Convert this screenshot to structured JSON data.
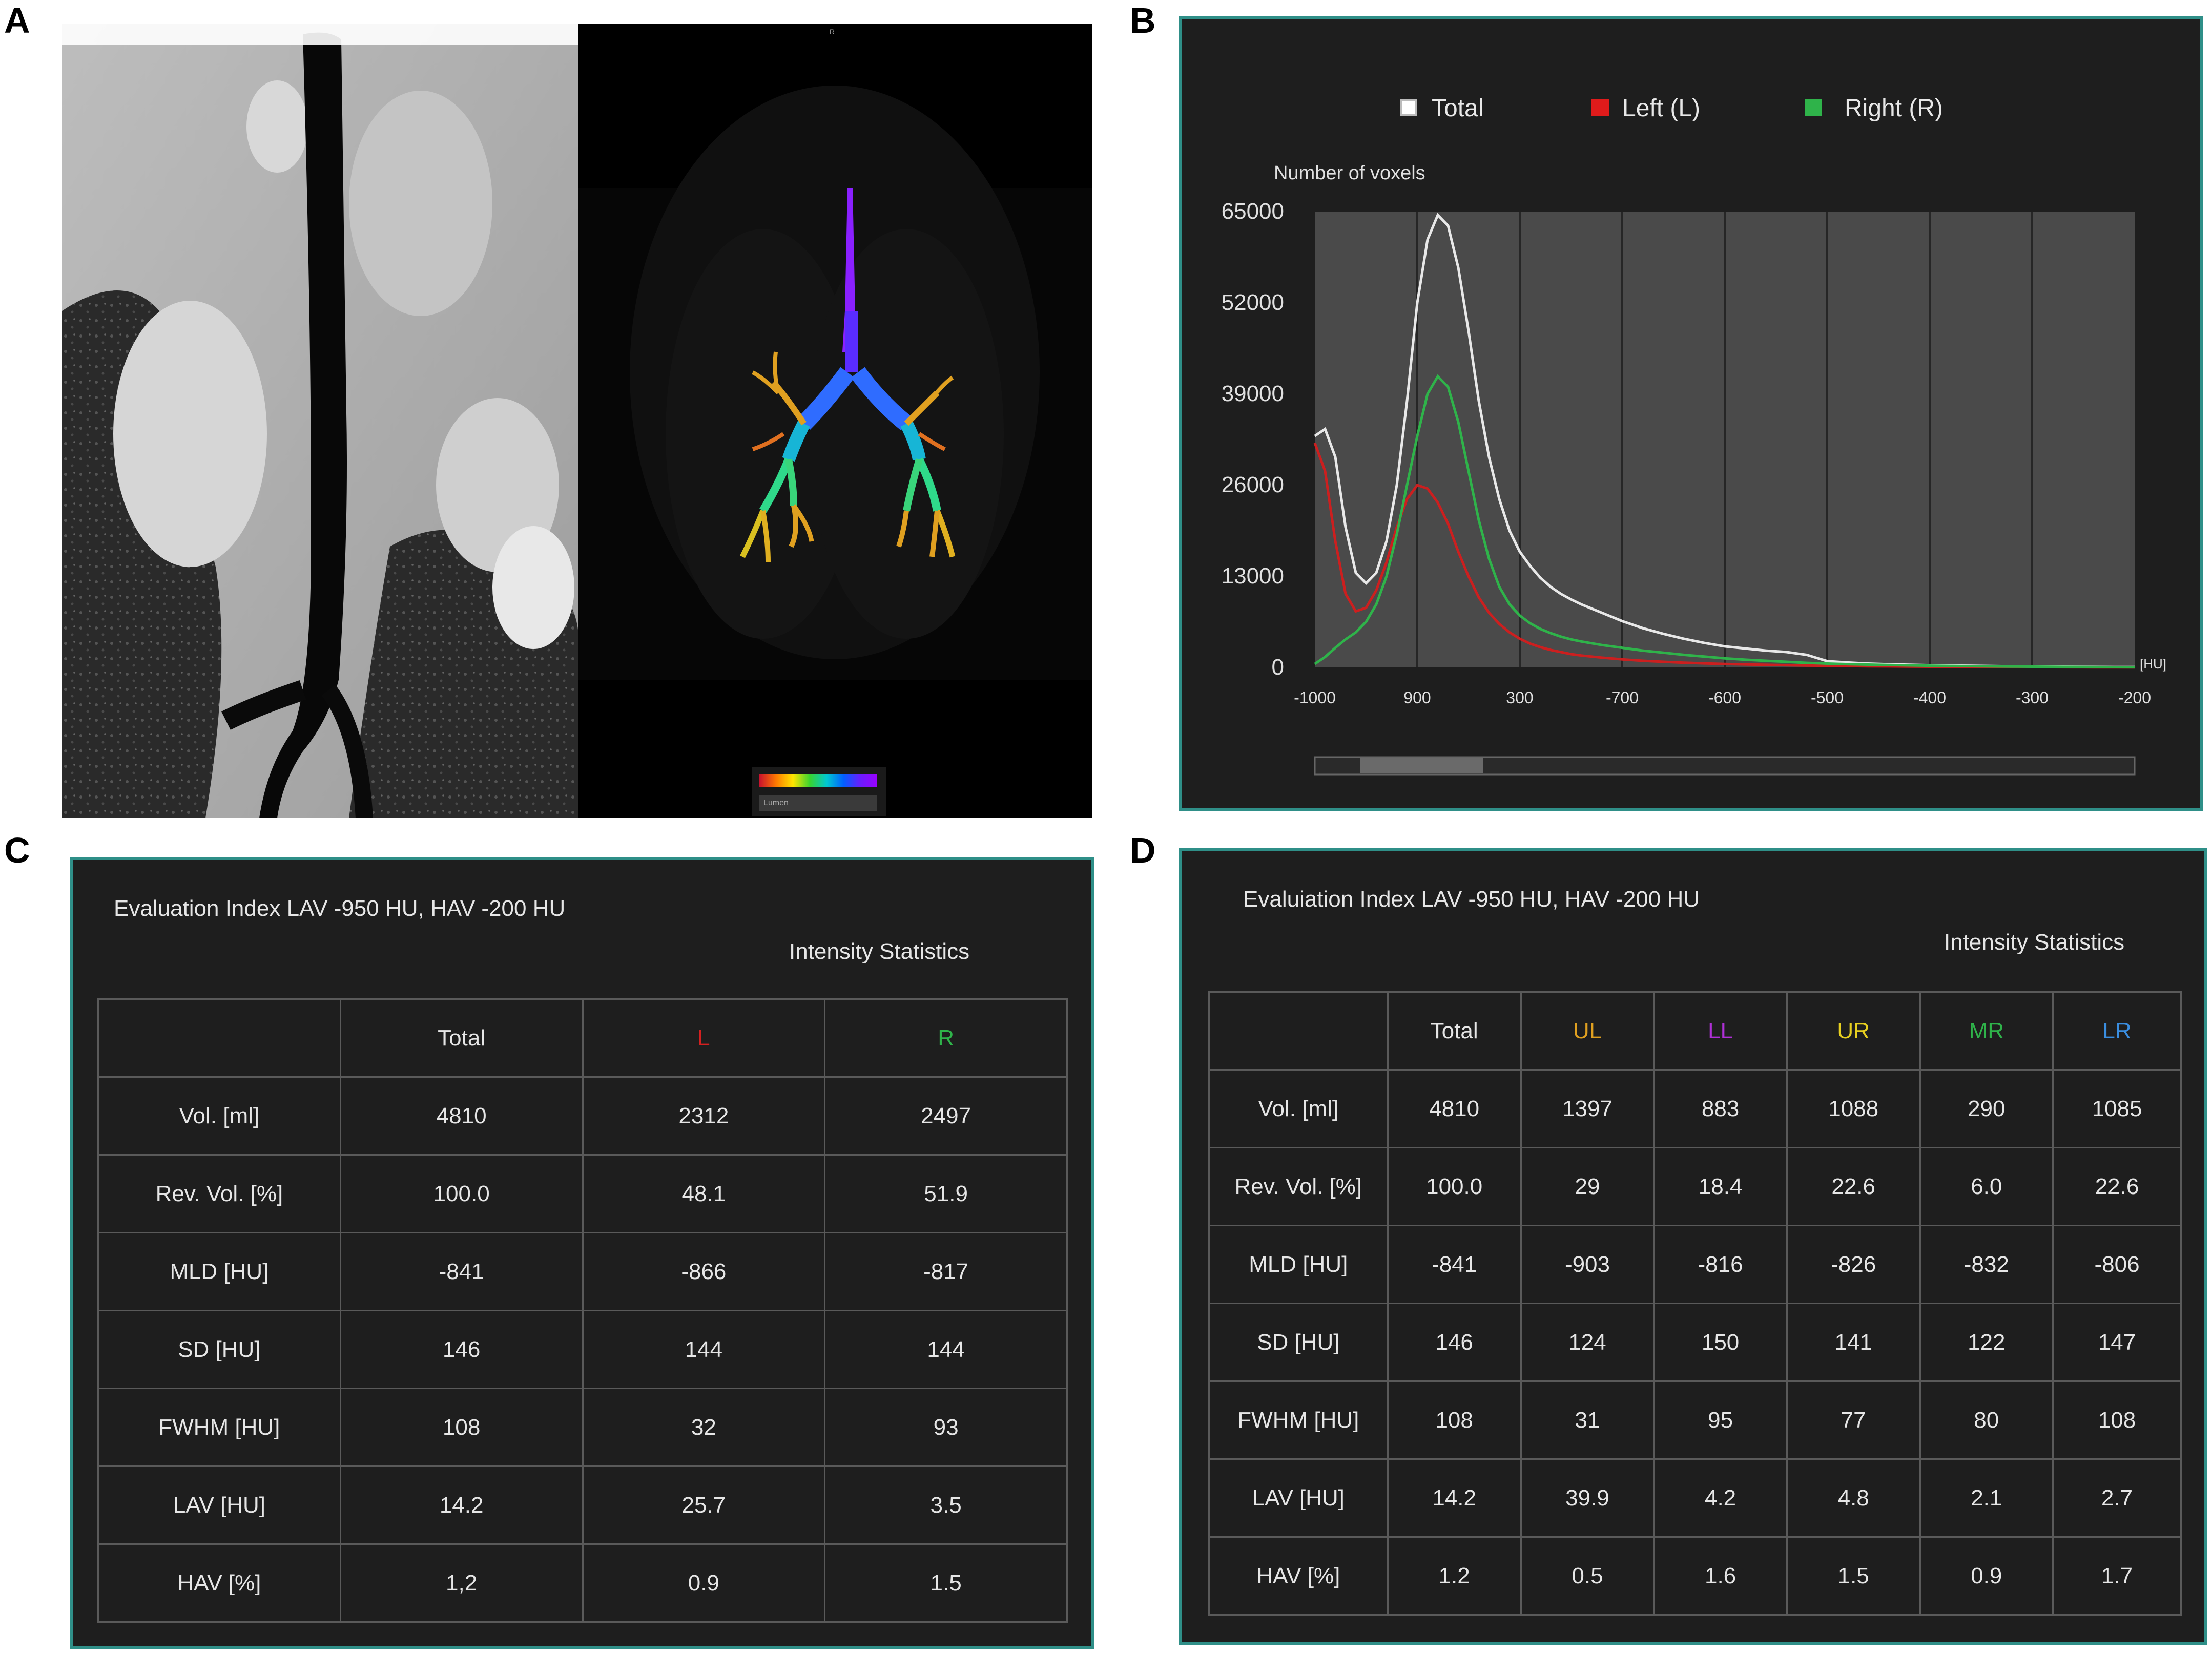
{
  "panel_labels": {
    "a": "A",
    "b": "B",
    "c": "C",
    "d": "D"
  },
  "panel_a": {
    "scan_marker": "R",
    "colormap_dropdown": "Lumen"
  },
  "chart_data": {
    "type": "line",
    "legend": [
      "Total",
      "Left (L)",
      "Right (R)"
    ],
    "legend_placement": "top",
    "ylabel": "Number of voxels",
    "xunit": "[HU]",
    "yticks": [
      "65000",
      "52000",
      "39000",
      "26000",
      "13000",
      "0"
    ],
    "ytick_values": [
      65000,
      52000,
      39000,
      26000,
      13000,
      0
    ],
    "xticks": [
      "-1000",
      "900",
      "300",
      "-700",
      "-600",
      "-500",
      "-400",
      "-300",
      "-200"
    ],
    "xlim": [
      -1000,
      -200
    ],
    "ylim": [
      0,
      65000
    ],
    "grid": "vertical",
    "series": [
      {
        "name": "Total",
        "color": "#e8e8e8",
        "x": [
          -1000,
          -990,
          -980,
          -970,
          -960,
          -950,
          -940,
          -930,
          -920,
          -910,
          -900,
          -890,
          -880,
          -870,
          -860,
          -850,
          -840,
          -830,
          -820,
          -810,
          -800,
          -790,
          -780,
          -770,
          -760,
          -750,
          -740,
          -720,
          -700,
          -680,
          -660,
          -640,
          -620,
          -600,
          -580,
          -560,
          -540,
          -520,
          -500,
          -480,
          -460,
          -440,
          -420,
          -400,
          -380,
          -360,
          -340,
          -320,
          -300,
          -280,
          -260,
          -240,
          -220,
          -200
        ],
        "y": [
          33000,
          34000,
          30000,
          20000,
          13500,
          12000,
          13500,
          18000,
          26000,
          38000,
          52000,
          61000,
          64500,
          63000,
          57000,
          48000,
          38000,
          30000,
          24000,
          19500,
          16500,
          14500,
          12800,
          11500,
          10500,
          9700,
          9000,
          7800,
          6600,
          5600,
          4800,
          4100,
          3500,
          3000,
          2700,
          2400,
          2200,
          1800,
          900,
          700,
          550,
          450,
          380,
          320,
          280,
          240,
          200,
          170,
          150,
          120,
          100,
          80,
          60,
          50
        ]
      },
      {
        "name": "Left (L)",
        "color": "#cc1f1f",
        "x": [
          -1000,
          -990,
          -980,
          -970,
          -960,
          -950,
          -940,
          -930,
          -920,
          -910,
          -900,
          -890,
          -880,
          -870,
          -860,
          -850,
          -840,
          -830,
          -820,
          -810,
          -800,
          -790,
          -780,
          -770,
          -760,
          -750,
          -740,
          -720,
          -700,
          -680,
          -660,
          -640,
          -620,
          -600,
          -580,
          -560,
          -540,
          -520,
          -500,
          -480,
          -460,
          -440,
          -420,
          -400,
          -380,
          -360,
          -340,
          -320,
          -300,
          -280,
          -260,
          -240,
          -220,
          -200
        ],
        "y": [
          32000,
          28000,
          18000,
          10500,
          8000,
          8500,
          11000,
          15000,
          20000,
          24000,
          26000,
          25500,
          23500,
          20500,
          16500,
          13000,
          10000,
          7800,
          6200,
          5000,
          4100,
          3400,
          2900,
          2500,
          2200,
          1900,
          1700,
          1400,
          1150,
          950,
          800,
          680,
          580,
          500,
          430,
          370,
          320,
          280,
          240,
          200,
          170,
          150,
          130,
          110,
          95,
          80,
          70,
          60,
          50,
          40,
          30,
          25,
          20,
          15
        ]
      },
      {
        "name": "Right (R)",
        "color": "#2fb34a",
        "x": [
          -1000,
          -990,
          -980,
          -970,
          -960,
          -950,
          -940,
          -930,
          -920,
          -910,
          -900,
          -890,
          -880,
          -870,
          -860,
          -850,
          -840,
          -830,
          -820,
          -810,
          -800,
          -790,
          -780,
          -770,
          -760,
          -750,
          -740,
          -720,
          -700,
          -680,
          -660,
          -640,
          -620,
          -600,
          -580,
          -560,
          -540,
          -520,
          -500,
          -480,
          -460,
          -440,
          -420,
          -400,
          -380,
          -360,
          -340,
          -320,
          -300,
          -280,
          -260,
          -240,
          -220,
          -200
        ],
        "y": [
          500,
          1500,
          2800,
          4000,
          5000,
          6500,
          9000,
          13000,
          19000,
          26000,
          33000,
          39000,
          41500,
          40000,
          35000,
          28000,
          21000,
          15500,
          11500,
          9000,
          7400,
          6300,
          5500,
          4900,
          4400,
          4000,
          3700,
          3200,
          2800,
          2400,
          2100,
          1800,
          1550,
          1300,
          1100,
          950,
          800,
          650,
          550,
          470,
          400,
          340,
          290,
          250,
          210,
          180,
          150,
          130,
          110,
          90,
          70,
          55,
          40,
          30
        ]
      }
    ]
  },
  "table_c": {
    "title": "Evaluation Index LAV -950 HU, HAV -200 HU",
    "subtitle": "Intensity Statistics",
    "headers": [
      "",
      "Total",
      "L",
      "R"
    ],
    "header_colors": [
      "#e6e6e6",
      "#e6e6e6",
      "#d42020",
      "#2fb34a"
    ],
    "rows": [
      [
        "Vol. [ml]",
        "4810",
        "2312",
        "2497"
      ],
      [
        "Rev. Vol. [%]",
        "100.0",
        "48.1",
        "51.9"
      ],
      [
        "MLD [HU]",
        "-841",
        "-866",
        "-817"
      ],
      [
        "SD [HU]",
        "146",
        "144",
        "144"
      ],
      [
        "FWHM [HU]",
        "108",
        "32",
        "93"
      ],
      [
        "LAV [HU]",
        "14.2",
        "25.7",
        "3.5"
      ],
      [
        "HAV [%]",
        "1,2",
        "0.9",
        "1.5"
      ]
    ]
  },
  "table_d": {
    "title": "Evaluiation Index LAV -950 HU, HAV -200 HU",
    "subtitle": "Intensity Statistics",
    "headers": [
      "",
      "Total",
      "UL",
      "LL",
      "UR",
      "MR",
      "LR"
    ],
    "header_colors": [
      "#e6e6e6",
      "#e6e6e6",
      "#e0a020",
      "#b030d8",
      "#e8d020",
      "#2fb34a",
      "#3a8ee0"
    ],
    "rows": [
      [
        "Vol. [ml]",
        "4810",
        "1397",
        "883",
        "1088",
        "290",
        "1085"
      ],
      [
        "Rev. Vol. [%]",
        "100.0",
        "29",
        "18.4",
        "22.6",
        "6.0",
        "22.6"
      ],
      [
        "MLD [HU]",
        "-841",
        "-903",
        "-816",
        "-826",
        "-832",
        "-806"
      ],
      [
        "SD [HU]",
        "146",
        "124",
        "150",
        "141",
        "122",
        "147"
      ],
      [
        "FWHM [HU]",
        "108",
        "31",
        "95",
        "77",
        "80",
        "108"
      ],
      [
        "LAV [HU]",
        "14.2",
        "39.9",
        "4.2",
        "4.8",
        "2.1",
        "2.7"
      ],
      [
        "HAV [%]",
        "1.2",
        "0.5",
        "1.6",
        "1.5",
        "0.9",
        "1.7"
      ]
    ]
  }
}
